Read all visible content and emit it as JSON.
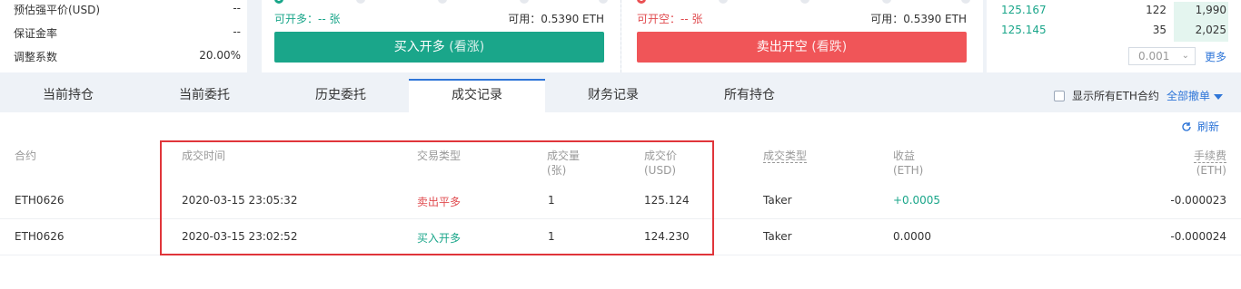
{
  "left_panel": {
    "rows": [
      {
        "label": "预估强平价(USD)",
        "value": "--"
      },
      {
        "label": "保证金率",
        "value": "--"
      },
      {
        "label": "调整系数",
        "value": "20.00%"
      }
    ]
  },
  "buy_panel": {
    "can_open": "可开多：-- 张",
    "available": "可用：0.5390 ETH",
    "button_main": "买入开多",
    "button_sub": "(看涨)"
  },
  "sell_panel": {
    "can_open": "可开空：-- 张",
    "available": "可用：0.5390 ETH",
    "button_main": "卖出开空",
    "button_sub": "(看跌)"
  },
  "order_book": {
    "rows": [
      {
        "price": "125.167",
        "amount": "122",
        "total": "1,990"
      },
      {
        "price": "125.145",
        "amount": "35",
        "total": "2,025"
      }
    ],
    "precision": "0.001",
    "more": "更多"
  },
  "tabs": [
    {
      "label": "当前持仓"
    },
    {
      "label": "当前委托"
    },
    {
      "label": "历史委托"
    },
    {
      "label": "成交记录"
    },
    {
      "label": "财务记录"
    },
    {
      "label": "所有持仓"
    }
  ],
  "show_all_label": "显示所有ETH合约",
  "cancel_all_label": "全部撤单",
  "refresh_label": "刷新",
  "table": {
    "headers": {
      "contract": "合约",
      "time": "成交时间",
      "trade_type": "交易类型",
      "volume": "成交量",
      "volume_unit": "(张)",
      "price": "成交价",
      "price_unit": "(USD)",
      "fill_type": "成交类型",
      "pnl": "收益",
      "pnl_unit": "(ETH)",
      "fee": "手续费",
      "fee_unit": "(ETH)"
    },
    "rows": [
      {
        "contract": "ETH0626",
        "time": "2020-03-15 23:05:32",
        "trade_type": "卖出平多",
        "volume": "1",
        "price": "125.124",
        "fill_type": "Taker",
        "pnl": "+0.0005",
        "fee": "-0.000023"
      },
      {
        "contract": "ETH0626",
        "time": "2020-03-15 23:02:52",
        "trade_type": "买入开多",
        "volume": "1",
        "price": "124.230",
        "fill_type": "Taker",
        "pnl": "0.0000",
        "fee": "-0.000024"
      }
    ]
  },
  "colors": {
    "accent": "#2f76d8",
    "buy": "#1aa68a",
    "sell": "#f05558",
    "highlight": "#e0353a"
  }
}
